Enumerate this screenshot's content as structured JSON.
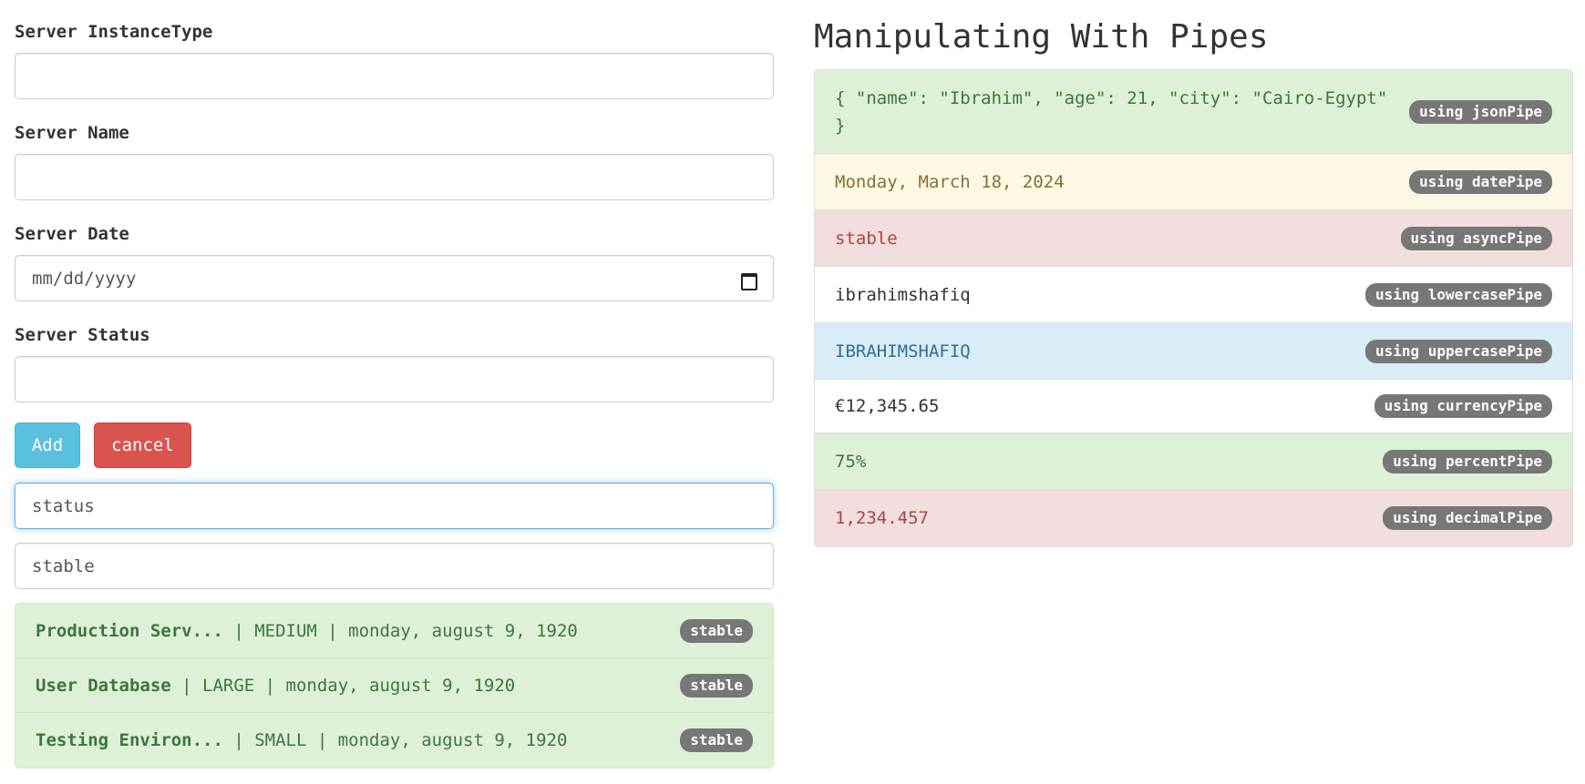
{
  "form": {
    "instance_type_label": "Server InstanceType",
    "instance_type_value": "",
    "name_label": "Server Name",
    "name_value": "",
    "date_label": "Server Date",
    "date_placeholder": "mm/dd/yyyy",
    "status_label": "Server Status",
    "status_value": "",
    "add_label": "Add",
    "cancel_label": "cancel",
    "filter_field_value": "status",
    "filter_value": "stable"
  },
  "servers": [
    {
      "name": "Production Serv...",
      "rest": " | MEDIUM | monday, august 9, 1920",
      "status": "stable"
    },
    {
      "name": "User Database",
      "rest": " | LARGE | monday, august 9, 1920",
      "status": "stable"
    },
    {
      "name": "Testing Environ...",
      "rest": " | SMALL | monday, august 9, 1920",
      "status": "stable"
    }
  ],
  "pipes": {
    "title": "Manipulating With Pipes",
    "rows": [
      {
        "text": "{ \"name\": \"Ibrahim\", \"age\": 21, \"city\": \"Cairo-Egypt\" }",
        "badge": "using jsonPipe",
        "style": "success"
      },
      {
        "text": "Monday, March 18, 2024",
        "badge": "using datePipe",
        "style": "warning"
      },
      {
        "text": "stable",
        "badge": "using asyncPipe",
        "style": "danger"
      },
      {
        "text": "ibrahimshafiq",
        "badge": "using lowercasePipe",
        "style": "plain"
      },
      {
        "text": "IBRAHIMSHAFIQ",
        "badge": "using uppercasePipe",
        "style": "info"
      },
      {
        "text": "€12,345.65",
        "badge": "using currencyPipe",
        "style": "plain"
      },
      {
        "text": "75%",
        "badge": "using percentPipe",
        "style": "success"
      },
      {
        "text": "1,234.457",
        "badge": "using decimalPipe",
        "style": "danger"
      }
    ]
  }
}
